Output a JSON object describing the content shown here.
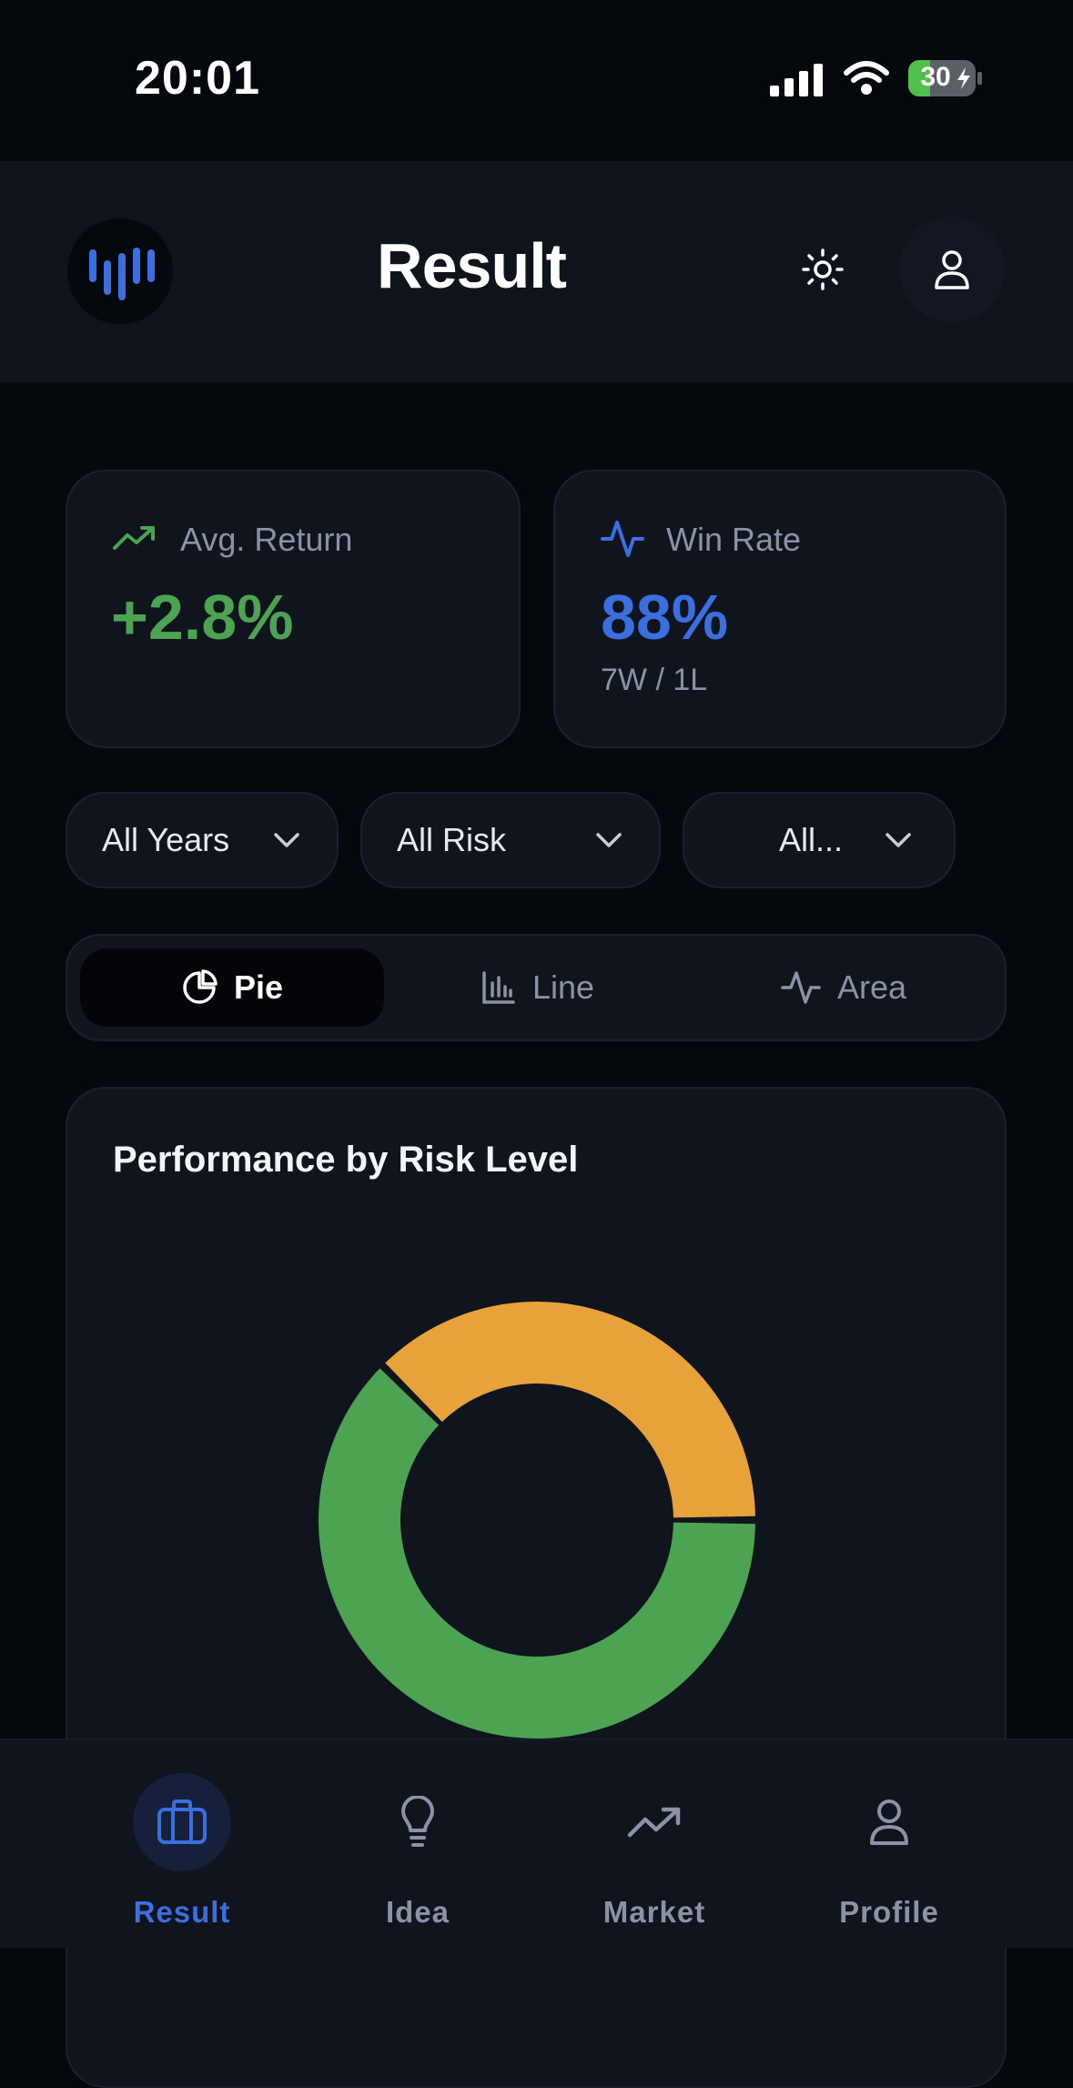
{
  "status_bar": {
    "time": "20:01",
    "battery": "30"
  },
  "header": {
    "title": "Result"
  },
  "stats": {
    "avg_return": {
      "label": "Avg. Return",
      "value": "+2.8%",
      "color": "#4ca352"
    },
    "win_rate": {
      "label": "Win Rate",
      "value": "88%",
      "sub": "7W / 1L",
      "color": "#3b6fe0"
    }
  },
  "filters": [
    {
      "label": "All Years"
    },
    {
      "label": "All Risk"
    },
    {
      "label": "All..."
    }
  ],
  "chart_tabs": [
    {
      "label": "Pie",
      "icon": "pie-chart-icon",
      "active": true
    },
    {
      "label": "Line",
      "icon": "bar-chart-icon",
      "active": false
    },
    {
      "label": "Area",
      "icon": "activity-icon",
      "active": false
    }
  ],
  "chart_card": {
    "title": "Performance by Risk Level"
  },
  "chart_data": {
    "type": "pie",
    "title": "Performance by Risk Level",
    "series": [
      {
        "value": 62.5,
        "color": "#4ca352"
      },
      {
        "value": 37.5,
        "color": "#e8a23a"
      }
    ]
  },
  "bottom_nav": [
    {
      "label": "Result",
      "icon": "briefcase-icon",
      "active": true
    },
    {
      "label": "Idea",
      "icon": "lightbulb-icon",
      "active": false
    },
    {
      "label": "Market",
      "icon": "trending-up-icon",
      "active": false
    },
    {
      "label": "Profile",
      "icon": "user-icon",
      "active": false
    }
  ],
  "colors": {
    "accent": "#3b6fe0",
    "positive": "#4ca352",
    "warning": "#e8a23a",
    "muted": "#8a93a6"
  }
}
